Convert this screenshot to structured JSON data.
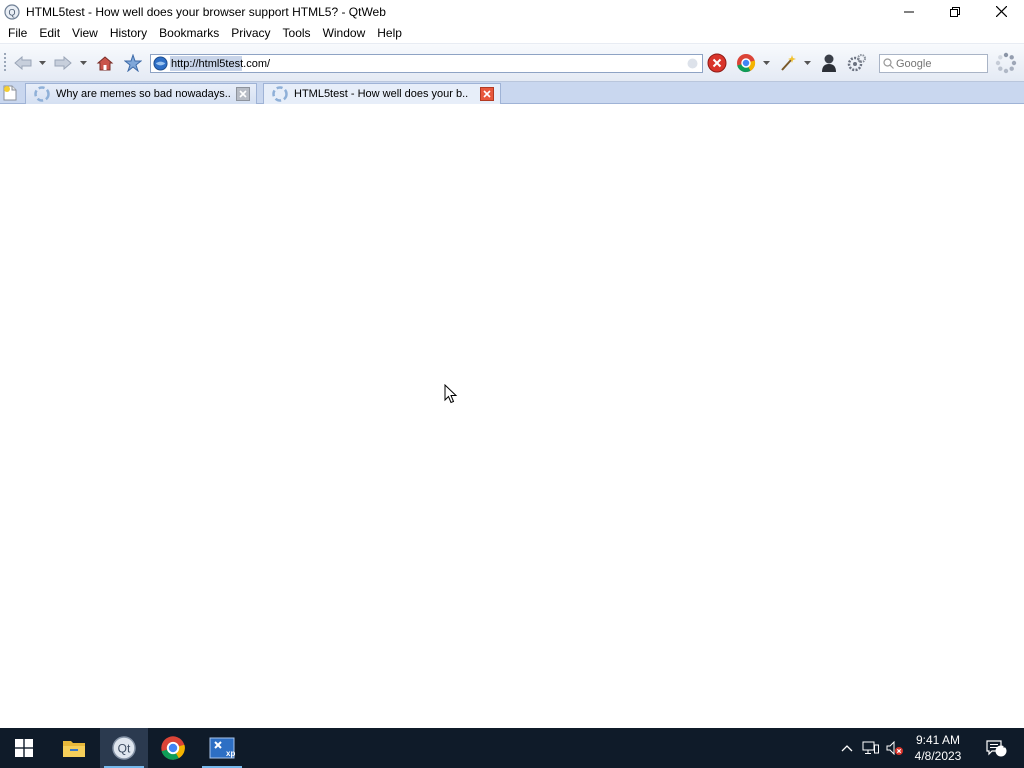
{
  "window": {
    "title": "HTML5test - How well does your browser support HTML5? - QtWeb"
  },
  "menu": [
    "File",
    "Edit",
    "View",
    "History",
    "Bookmarks",
    "Privacy",
    "Tools",
    "Window",
    "Help"
  ],
  "toolbar": {
    "url": "http://html5test.com/",
    "search_placeholder": "Google"
  },
  "tabs": [
    {
      "label": "Why are memes so bad nowadays...",
      "active": false
    },
    {
      "label": "HTML5test - How well does your b...",
      "active": true
    }
  ],
  "taskbar": {
    "apps": [
      "start-icon",
      "file-explorer-icon",
      "qtweb-icon",
      "chrome-icon",
      "xp-app-icon"
    ],
    "time": "9:41 AM",
    "date": "4/8/2023",
    "notification_count": "4"
  },
  "colors": {
    "tab_bar": "#c9d7ef",
    "taskbar": "#0f1b29",
    "close_tab_red": "#e8583c"
  }
}
